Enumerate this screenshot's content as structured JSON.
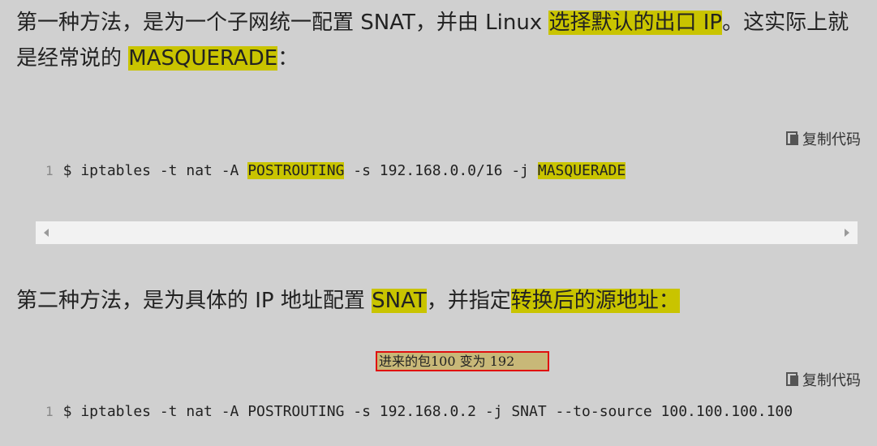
{
  "para1": {
    "part1": "第一种方法，是为一个子网统一配置 SNAT，并由 Linux ",
    "hl1": "选择默认的出口 IP",
    "part2": "。这实际上就是经常说的 ",
    "hl2": "MASQUERADE",
    "part3": "："
  },
  "code1": {
    "copy_label": "复制代码",
    "line_no": "1",
    "seg1": "$ iptables -t nat -A ",
    "hl1": "POSTROUTING",
    "seg2": " -s 192.168.0.0/16 -j ",
    "hl2": "MASQUERADE"
  },
  "para2": {
    "part1": "第二种方法，是为具体的 IP 地址配置 ",
    "hl1": "SNAT",
    "part2": "，并指定",
    "hl2": "转换后的源地址："
  },
  "annotation": "进来的包100 变为 192",
  "code2": {
    "copy_label": "复制代码",
    "line_no": "1",
    "text": "$ iptables -t nat -A POSTROUTING -s 192.168.0.2 -j SNAT --to-source 100.100.100.100"
  },
  "colors": {
    "highlight": "#c9c400",
    "annotation_border": "#e01010",
    "annotation_fill": "#c8b878"
  }
}
